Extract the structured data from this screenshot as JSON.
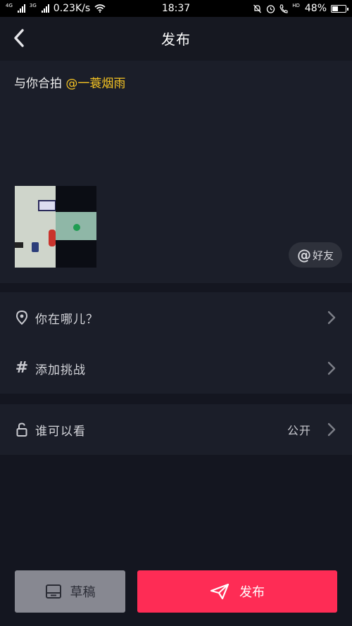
{
  "status_bar": {
    "net_tag_1": "4G",
    "net_tag_2": "3G",
    "speed": "0.23K/s",
    "time": "18:37",
    "hd_tag": "HD",
    "battery": "48%",
    "battery_level": 0.48
  },
  "header": {
    "title": "发布",
    "back_icon": "chevron-left-icon"
  },
  "caption": {
    "prefix": "与你合拍 ",
    "mention": "@一蓑烟雨"
  },
  "friend_button": {
    "at_symbol": "@",
    "label": "好友"
  },
  "rows": {
    "location": {
      "label": "你在哪儿？",
      "icon": "location-pin-icon"
    },
    "challenge": {
      "label": "添加挑战",
      "icon": "hashtag-icon"
    },
    "visibility": {
      "label": "谁可以看",
      "value": "公开",
      "icon": "unlock-icon"
    }
  },
  "buttons": {
    "draft": "草稿",
    "publish": "发布"
  },
  "colors": {
    "accent": "#fe2c55",
    "mention": "#f7c523",
    "background": "#141620",
    "panel": "#1b1e29"
  }
}
